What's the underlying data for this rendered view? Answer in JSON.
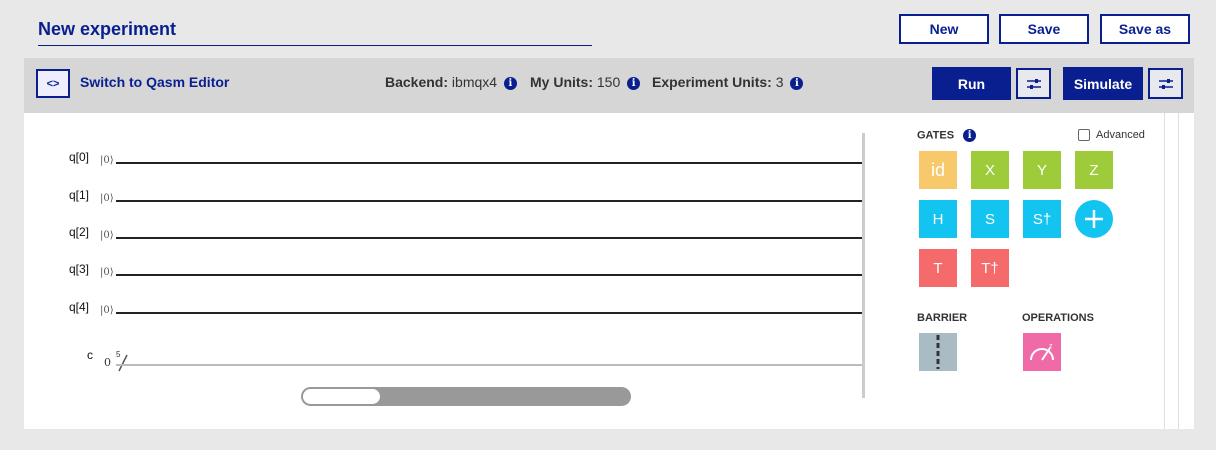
{
  "header": {
    "experiment_title": "New experiment",
    "new_label": "New",
    "save_label": "Save",
    "save_as_label": "Save as"
  },
  "toolbar": {
    "switch_icon": "<>",
    "switch_label": "Switch to Qasm Editor",
    "backend_label": "Backend:",
    "backend_value": "ibmqx4",
    "my_units_label": "My Units:",
    "my_units_value": "150",
    "experiment_units_label": "Experiment Units:",
    "experiment_units_value": "3",
    "run_label": "Run",
    "simulate_label": "Simulate",
    "info_glyph": "i"
  },
  "circuit": {
    "qubits": [
      {
        "label": "q[0]",
        "init": "|0⟩"
      },
      {
        "label": "q[1]",
        "init": "|0⟩"
      },
      {
        "label": "q[2]",
        "init": "|0⟩"
      },
      {
        "label": "q[3]",
        "init": "|0⟩"
      },
      {
        "label": "q[4]",
        "init": "|0⟩"
      }
    ],
    "classical": {
      "label": "c",
      "init": "0",
      "width": "5"
    }
  },
  "palette": {
    "gates_heading": "GATES",
    "advanced_label": "Advanced",
    "gates": [
      {
        "label": "id",
        "color": "#f7c96a"
      },
      {
        "label": "X",
        "color": "#9dcb3a"
      },
      {
        "label": "Y",
        "color": "#9dcb3a"
      },
      {
        "label": "Z",
        "color": "#9dcb3a"
      },
      {
        "label": "H",
        "color": "#12c4ef"
      },
      {
        "label": "S",
        "color": "#12c4ef"
      },
      {
        "label": "S†",
        "color": "#12c4ef"
      },
      {
        "label": "T",
        "color": "#f56a6a"
      },
      {
        "label": "T†",
        "color": "#f56a6a"
      }
    ],
    "add_gate_icon": "plus-icon",
    "barrier_heading": "BARRIER",
    "operations_heading": "OPERATIONS",
    "barrier_color": "#a9bcc4",
    "measure_color": "#f06aa8"
  },
  "colors": {
    "brand": "#0a1f8f"
  }
}
